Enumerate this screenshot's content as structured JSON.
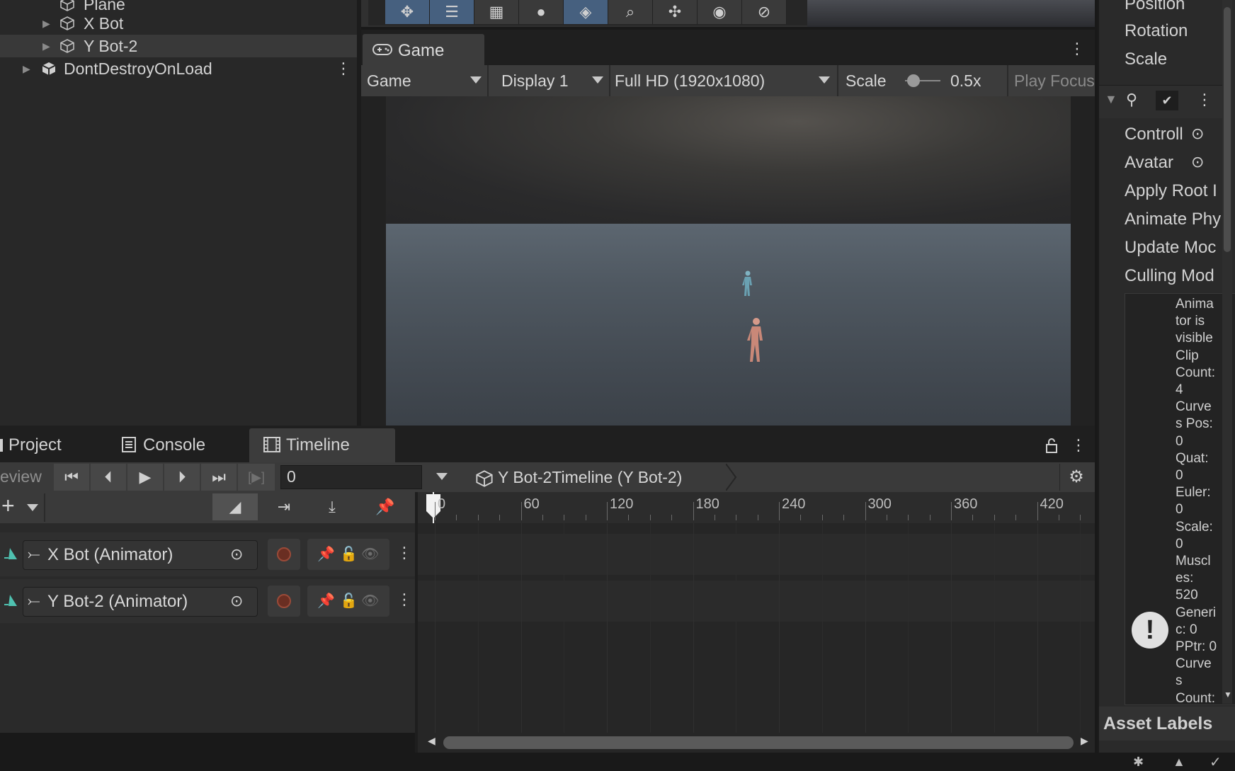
{
  "hierarchy": {
    "items": [
      {
        "label": "Plane"
      },
      {
        "label": "X Bot"
      },
      {
        "label": "Y Bot-2"
      },
      {
        "label": "DontDestroyOnLoad"
      }
    ]
  },
  "game": {
    "tab_label": "Game",
    "mode_select": "Game",
    "display_select": "Display 1",
    "resolution_select": "Full HD (1920x1080)",
    "scale_label": "Scale",
    "scale_value": "0.5x",
    "scale_fraction": 0.1,
    "play_focus": "Play Focus"
  },
  "bottom_tabs": {
    "project": "Project",
    "console": "Console",
    "timeline": "Timeline"
  },
  "timeline": {
    "preview_label": "eview",
    "frame_value": "0",
    "breadcrumb": "Y Bot-2Timeline (Y Bot-2)",
    "ruler_ticks": [
      "0",
      "60",
      "120",
      "180",
      "240",
      "300",
      "360",
      "420"
    ],
    "tracks": [
      {
        "label": "X Bot (Animator)"
      },
      {
        "label": "Y Bot-2 (Animator)"
      }
    ]
  },
  "inspector": {
    "transform_fields": [
      "Position",
      "Rotation",
      "Scale"
    ],
    "animator_fields": [
      "Controll",
      "Avatar",
      "Apply Root I",
      "Animate Phy",
      "Update Moc",
      "Culling Mod"
    ],
    "info_text": "Anima\ntor is\nvisible\nClip\nCount:\n 4\nCurve\ns Pos:\n0\nQuat:\n0\nEuler:\n0\nScale:\n0\nMuscl\nes:\n520\nGeneri\nc: 0\nPPtr: 0\nCurve\ns\nCount:",
    "asset_labels": "Asset Labels"
  },
  "colors": {
    "accent_blue": "#46607f",
    "timeline_track_accent": "#4fc1b0",
    "record_red": "#6a2e22"
  }
}
